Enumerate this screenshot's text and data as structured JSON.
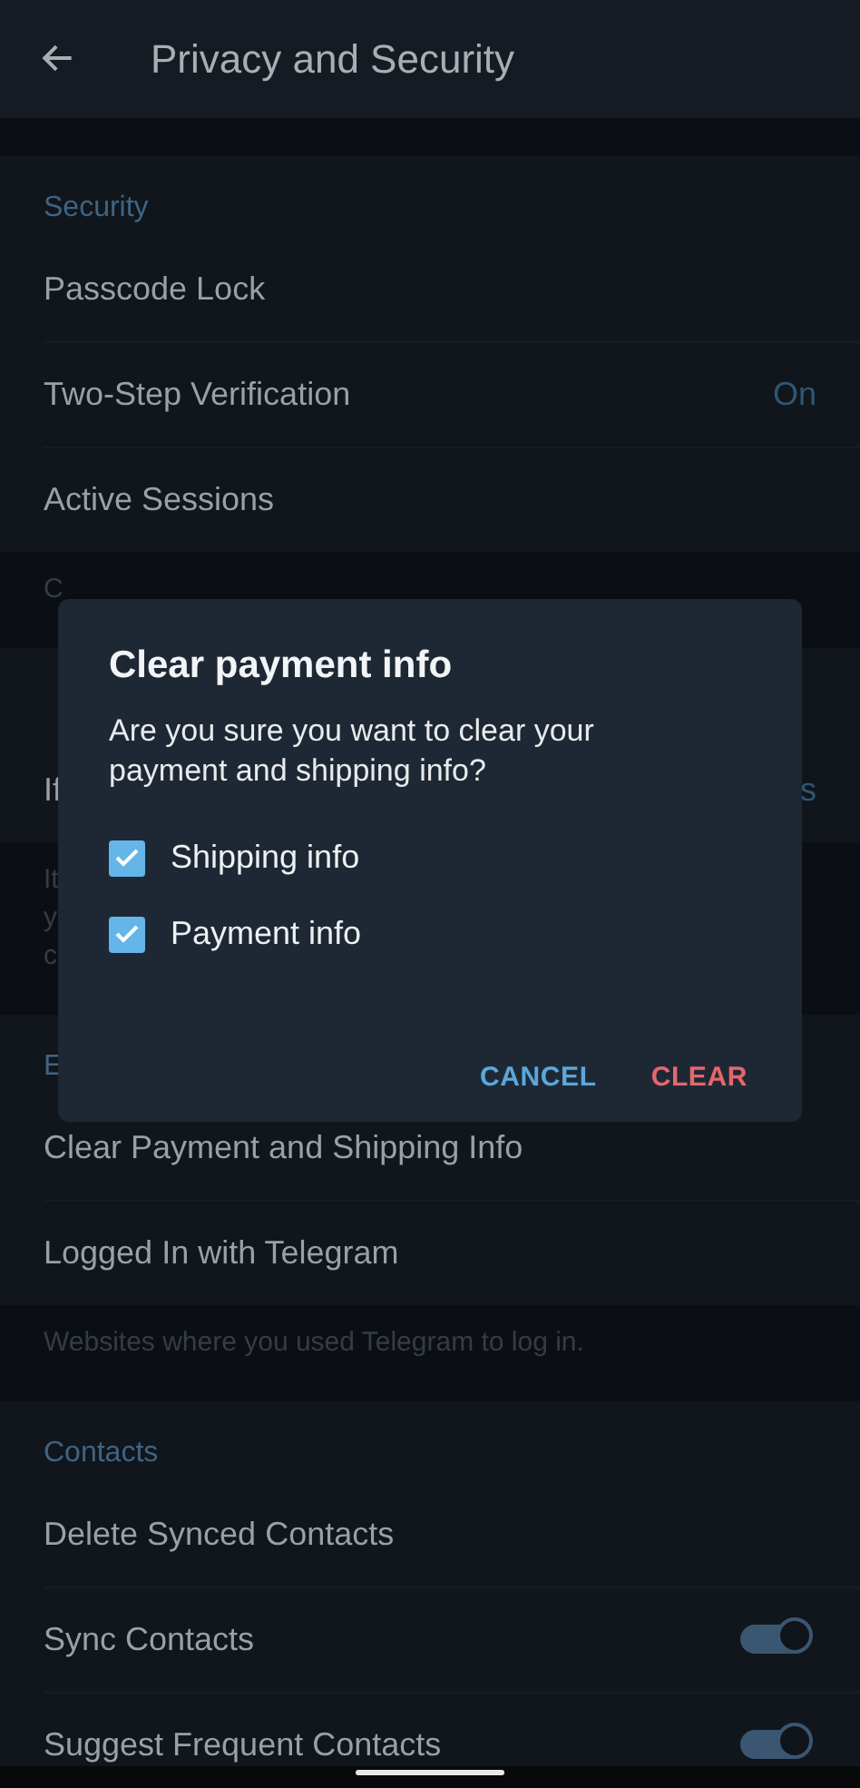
{
  "header": {
    "title": "Privacy and Security"
  },
  "sections": [
    {
      "title": "Security",
      "items": [
        {
          "kind": "text",
          "label": "Passcode Lock"
        },
        {
          "kind": "value",
          "label": "Two-Step Verification",
          "value": "On"
        },
        {
          "kind": "text",
          "label": "Active Sessions"
        }
      ],
      "hint": [
        "C"
      ]
    },
    {
      "items": [
        {
          "kind": "value",
          "label": "If",
          "value": "s"
        }
      ],
      "hint": [
        "It",
        "y",
        "c"
      ]
    },
    {
      "title": "E",
      "items": [
        {
          "kind": "text",
          "label": "Clear Payment and Shipping Info"
        },
        {
          "kind": "text",
          "label": "Logged In with Telegram"
        }
      ],
      "hint": [
        "Websites where you used Telegram to log in."
      ]
    },
    {
      "title": "Contacts",
      "items": [
        {
          "kind": "text",
          "label": "Delete Synced Contacts"
        },
        {
          "kind": "toggle",
          "label": "Sync Contacts",
          "on": true
        },
        {
          "kind": "toggle",
          "label": "Suggest Frequent Contacts",
          "on": true
        }
      ]
    }
  ],
  "dialog": {
    "title": "Clear payment info",
    "message": "Are you sure you want to clear your payment and shipping info?",
    "options": [
      {
        "label": "Shipping info",
        "checked": true
      },
      {
        "label": "Payment info",
        "checked": true
      }
    ],
    "buttons": [
      {
        "label": "CANCEL",
        "kind": "cancel"
      },
      {
        "label": "CLEAR",
        "kind": "destructive"
      }
    ]
  }
}
